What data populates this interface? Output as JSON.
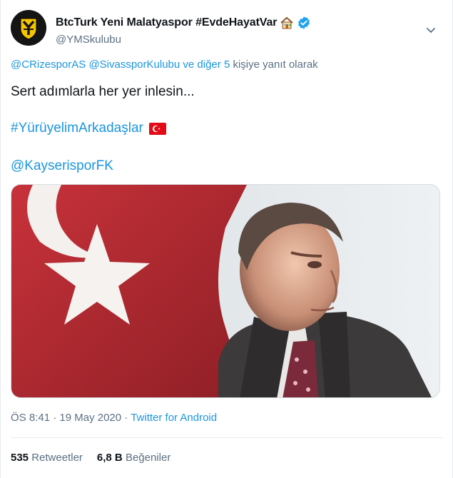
{
  "author": {
    "display_name": "BtcTurk Yeni Malatyaspor #EvdeHayatVar",
    "house_icon": "house-emoji",
    "verified_icon": "verified-badge",
    "handle": "@YMSkulubu",
    "avatar_icon": "club-crest"
  },
  "reply": {
    "mention1": "@CRizesporAS",
    "mention2": "@SivassporKulubu",
    "and_others": "ve diğer 5",
    "suffix": "kişiye yanıt olarak"
  },
  "tweet": {
    "text": "Sert adımlarla her yer inlesin...",
    "hashtag": "#YürüyelimArkadaşlar",
    "flag_icon": "turkey-flag-emoji",
    "mention": "@KayserisporFK"
  },
  "meta": {
    "time": "ÖS 8:41",
    "separator1": "·",
    "date": "19 May 2020",
    "separator2": "·",
    "source": "Twitter for Android"
  },
  "stats": {
    "retweets_count": "535",
    "retweets_label": "Retweetler",
    "likes_count": "6,8 B",
    "likes_label": "Beğeniler"
  },
  "colors": {
    "link": "#1b95e0",
    "secondary_text": "#5b7083",
    "flag_red": "#e30a17",
    "verified": "#1da1f2"
  }
}
